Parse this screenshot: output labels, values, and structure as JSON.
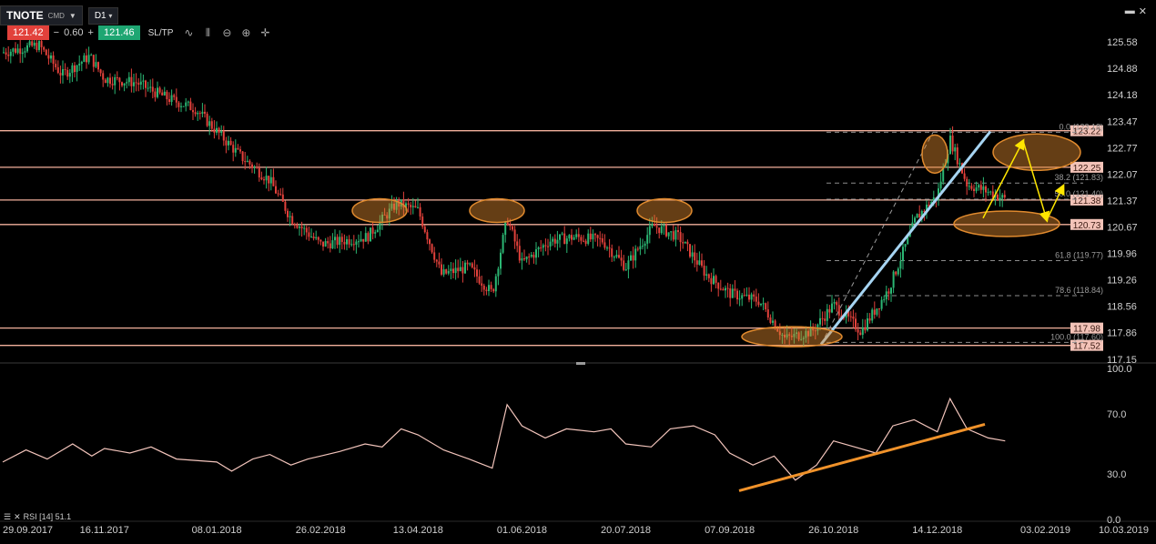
{
  "toolbar": {
    "symbol": "TNOTE",
    "symbol_type": "CMD",
    "timeframe": "D1",
    "sell_price": "121.42",
    "spread_minus": "−",
    "spread_value": "0.60",
    "spread_plus": "+",
    "buy_price": "121.46",
    "sltp_label": "SL/TP"
  },
  "rsi_label": "RSI [14] 51.1",
  "colors": {
    "up": "#2bb673",
    "down": "#e2413b",
    "hline": "#f2b09c",
    "trend": "#a6d4f2",
    "ellipse": "#e08a2e",
    "arrow": "#ffe600",
    "rsi": "#f2c4bb",
    "rsi_trend": "#f0922a"
  },
  "chart_data": [
    {
      "type": "candlestick",
      "y_ticks": [
        "125.58",
        "124.88",
        "124.18",
        "123.47",
        "122.77",
        "122.07",
        "121.37",
        "120.67",
        "119.96",
        "119.26",
        "118.56",
        "117.86",
        "117.15"
      ],
      "x_ticks": [
        "29.09.2017",
        "16.11.2017",
        "08.01.2018",
        "26.02.2018",
        "13.04.2018",
        "01.06.2018",
        "20.07.2018",
        "07.09.2018",
        "26.10.2018",
        "14.12.2018",
        "03.02.2019",
        "10.03.2019"
      ],
      "ylim": [
        117.1,
        126.0
      ],
      "price_levels": [
        "123.22",
        "122.25",
        "121.38",
        "120.73",
        "117.98",
        "117.52"
      ],
      "fib_levels": [
        {
          "label": "0.0 (123.18)",
          "value": 123.18
        },
        {
          "label": "38.2 (121.83)",
          "value": 121.83
        },
        {
          "label": "50.0 (121.40)",
          "value": 121.4
        },
        {
          "label": "61.8 (119.77)",
          "value": 119.77
        },
        {
          "label": "78.6 (118.84)",
          "value": 118.84
        },
        {
          "label": "100.0 (117.60)",
          "value": 117.6
        }
      ],
      "close_path": [
        {
          "date": "29.09.2017",
          "value": 125.3
        },
        {
          "date": "16.10.2017",
          "value": 125.5
        },
        {
          "date": "27.10.2017",
          "value": 124.7
        },
        {
          "date": "09.11.2017",
          "value": 125.2
        },
        {
          "date": "16.11.2017",
          "value": 124.6
        },
        {
          "date": "01.12.2017",
          "value": 124.5
        },
        {
          "date": "15.12.2017",
          "value": 124.1
        },
        {
          "date": "29.12.2017",
          "value": 123.8
        },
        {
          "date": "08.01.2018",
          "value": 123.2
        },
        {
          "date": "20.01.2018",
          "value": 122.5
        },
        {
          "date": "02.02.2018",
          "value": 121.9
        },
        {
          "date": "12.02.2018",
          "value": 120.9
        },
        {
          "date": "26.02.2018",
          "value": 120.2
        },
        {
          "date": "09.03.2018",
          "value": 120.3
        },
        {
          "date": "20.03.2018",
          "value": 120.4
        },
        {
          "date": "03.04.2018",
          "value": 121.3
        },
        {
          "date": "13.04.2018",
          "value": 121.1
        },
        {
          "date": "24.04.2018",
          "value": 119.4
        },
        {
          "date": "07.05.2018",
          "value": 119.6
        },
        {
          "date": "18.05.2018",
          "value": 118.9
        },
        {
          "date": "25.05.2018",
          "value": 120.9
        },
        {
          "date": "01.06.2018",
          "value": 119.7
        },
        {
          "date": "14.06.2018",
          "value": 120.3
        },
        {
          "date": "26.06.2018",
          "value": 120.4
        },
        {
          "date": "09.07.2018",
          "value": 120.3
        },
        {
          "date": "20.07.2018",
          "value": 119.6
        },
        {
          "date": "02.08.2018",
          "value": 120.7
        },
        {
          "date": "14.08.2018",
          "value": 120.4
        },
        {
          "date": "27.08.2018",
          "value": 119.4
        },
        {
          "date": "07.09.2018",
          "value": 118.9
        },
        {
          "date": "21.09.2018",
          "value": 118.7
        },
        {
          "date": "03.10.2018",
          "value": 117.7
        },
        {
          "date": "16.10.2018",
          "value": 117.9
        },
        {
          "date": "26.10.2018",
          "value": 118.6
        },
        {
          "date": "08.11.2018",
          "value": 117.9
        },
        {
          "date": "21.11.2018",
          "value": 119.0
        },
        {
          "date": "04.12.2018",
          "value": 120.9
        },
        {
          "date": "14.12.2018",
          "value": 121.5
        },
        {
          "date": "20.12.2018",
          "value": 123.0
        },
        {
          "date": "28.12.2018",
          "value": 121.8
        },
        {
          "date": "07.01.2019",
          "value": 121.6
        },
        {
          "date": "15.01.2019",
          "value": 121.4
        }
      ]
    },
    {
      "type": "line",
      "name": "RSI [14]",
      "y_ticks": [
        "100.0",
        "70.0",
        "30.0",
        "0.0"
      ],
      "ylim": [
        0,
        100
      ],
      "x": [
        "29.09.2017",
        "10.10.2017",
        "20.10.2017",
        "01.11.2017",
        "10.11.2017",
        "16.11.2017",
        "28.11.2017",
        "08.12.2017",
        "20.12.2017",
        "08.01.2018",
        "15.01.2018",
        "25.01.2018",
        "02.02.2018",
        "12.02.2018",
        "20.02.2018",
        "26.02.2018",
        "07.03.2018",
        "19.03.2018",
        "27.03.2018",
        "05.04.2018",
        "13.04.2018",
        "25.04.2018",
        "07.05.2018",
        "18.05.2018",
        "25.05.2018",
        "01.06.2018",
        "12.06.2018",
        "22.06.2018",
        "05.07.2018",
        "13.07.2018",
        "20.07.2018",
        "01.08.2018",
        "10.08.2018",
        "21.08.2018",
        "31.08.2018",
        "07.09.2018",
        "18.09.2018",
        "28.09.2018",
        "08.10.2018",
        "18.10.2018",
        "26.10.2018",
        "05.11.2018",
        "15.11.2018",
        "23.11.2018",
        "03.12.2018",
        "14.12.2018",
        "20.12.2018",
        "28.12.2018",
        "07.01.2019",
        "15.01.2019"
      ],
      "values": [
        38,
        46,
        40,
        50,
        42,
        47,
        44,
        48,
        40,
        38,
        32,
        40,
        43,
        36,
        40,
        42,
        45,
        50,
        48,
        60,
        56,
        46,
        40,
        34,
        76,
        62,
        54,
        60,
        58,
        60,
        50,
        48,
        60,
        62,
        56,
        44,
        36,
        42,
        26,
        36,
        52,
        48,
        44,
        62,
        66,
        58,
        80,
        60,
        54,
        52
      ]
    }
  ]
}
